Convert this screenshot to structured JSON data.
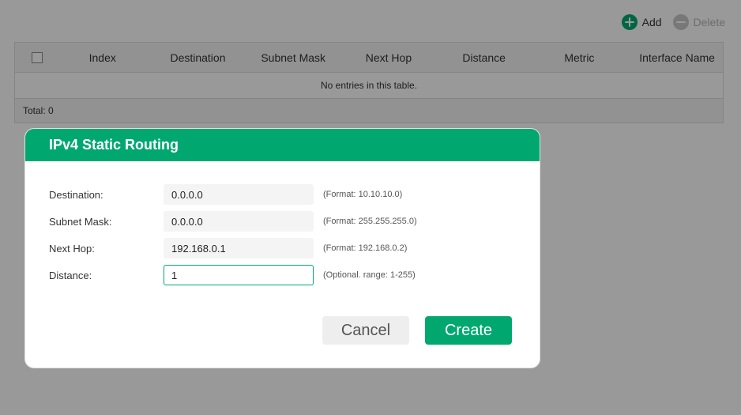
{
  "toolbar": {
    "add_label": "Add",
    "delete_label": "Delete",
    "add_icon": "plus-icon",
    "delete_icon": "minus-icon"
  },
  "table": {
    "columns": [
      "Index",
      "Destination",
      "Subnet Mask",
      "Next Hop",
      "Distance",
      "Metric",
      "Interface Name"
    ],
    "empty_message": "No entries in this table.",
    "total_label": "Total: 0"
  },
  "dialog": {
    "title": "IPv4 Static Routing",
    "fields": [
      {
        "label": "Destination:",
        "value": "0.0.0.0",
        "hint": "(Format: 10.10.10.0)"
      },
      {
        "label": "Subnet Mask:",
        "value": "0.0.0.0",
        "hint": "(Format: 255.255.255.0)"
      },
      {
        "label": "Next Hop:",
        "value": "192.168.0.1",
        "hint": "(Format: 192.168.0.2)"
      },
      {
        "label": "Distance:",
        "value": "1",
        "hint": "(Optional. range: 1-255)"
      }
    ],
    "cancel_label": "Cancel",
    "create_label": "Create"
  },
  "colors": {
    "accent": "#00a870",
    "disabled": "#c8c8c8",
    "overlay": "rgba(0,0,0,0.4)"
  }
}
